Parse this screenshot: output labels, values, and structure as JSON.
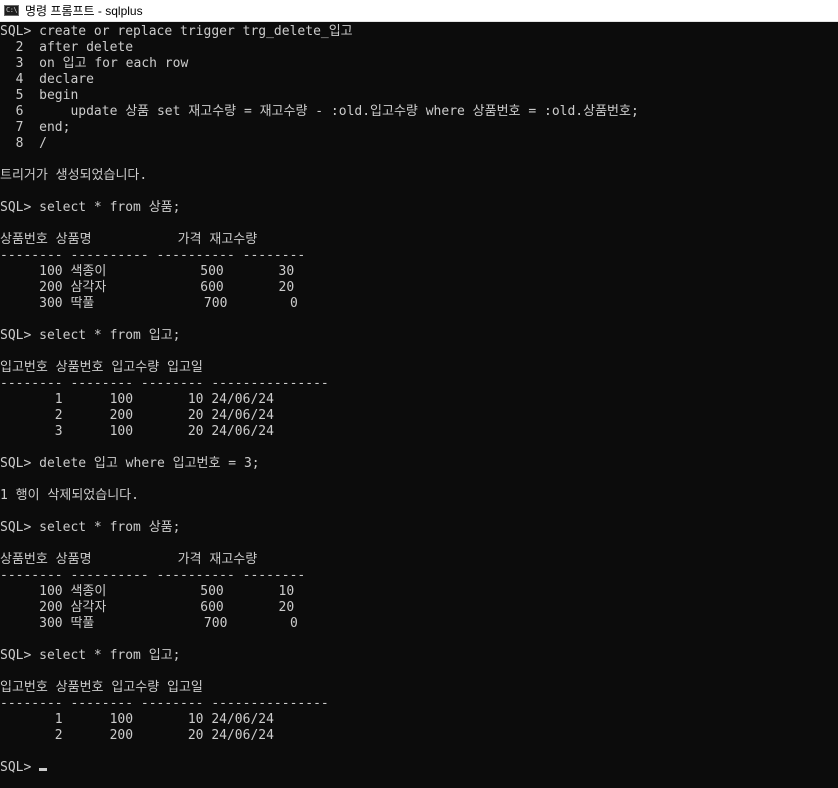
{
  "window": {
    "title": "명령 프롬프트 - sqlplus",
    "icon_label": "C:\\"
  },
  "console": {
    "lines": [
      "SQL> create or replace trigger trg_delete_입고",
      "  2  after delete",
      "  3  on 입고 for each row",
      "  4  declare",
      "  5  begin",
      "  6      update 상품 set 재고수량 = 재고수량 - :old.입고수량 where 상품번호 = :old.상품번호;",
      "  7  end;",
      "  8  /",
      "",
      "트리거가 생성되었습니다.",
      "",
      "SQL> select * from 상품;",
      "",
      "상품번호 상품명           가격 재고수량",
      "-------- ---------- ---------- --------",
      "     100 색종이            500       30",
      "     200 삼각자            600       20",
      "     300 딱풀              700        0",
      "",
      "SQL> select * from 입고;",
      "",
      "입고번호 상품번호 입고수량 입고일",
      "-------- -------- -------- ---------------",
      "       1      100       10 24/06/24",
      "       2      200       20 24/06/24",
      "       3      100       20 24/06/24",
      "",
      "SQL> delete 입고 where 입고번호 = 3;",
      "",
      "1 행이 삭제되었습니다.",
      "",
      "SQL> select * from 상품;",
      "",
      "상품번호 상품명           가격 재고수량",
      "-------- ---------- ---------- --------",
      "     100 색종이            500       10",
      "     200 삼각자            600       20",
      "     300 딱풀              700        0",
      "",
      "SQL> select * from 입고;",
      "",
      "입고번호 상품번호 입고수량 입고일",
      "-------- -------- -------- ---------------",
      "       1      100       10 24/06/24",
      "       2      200       20 24/06/24",
      ""
    ],
    "prompt": "SQL> "
  },
  "colors": {
    "background": "#0c0c0c",
    "text": "#cccccc",
    "titlebar": "#ffffff"
  }
}
